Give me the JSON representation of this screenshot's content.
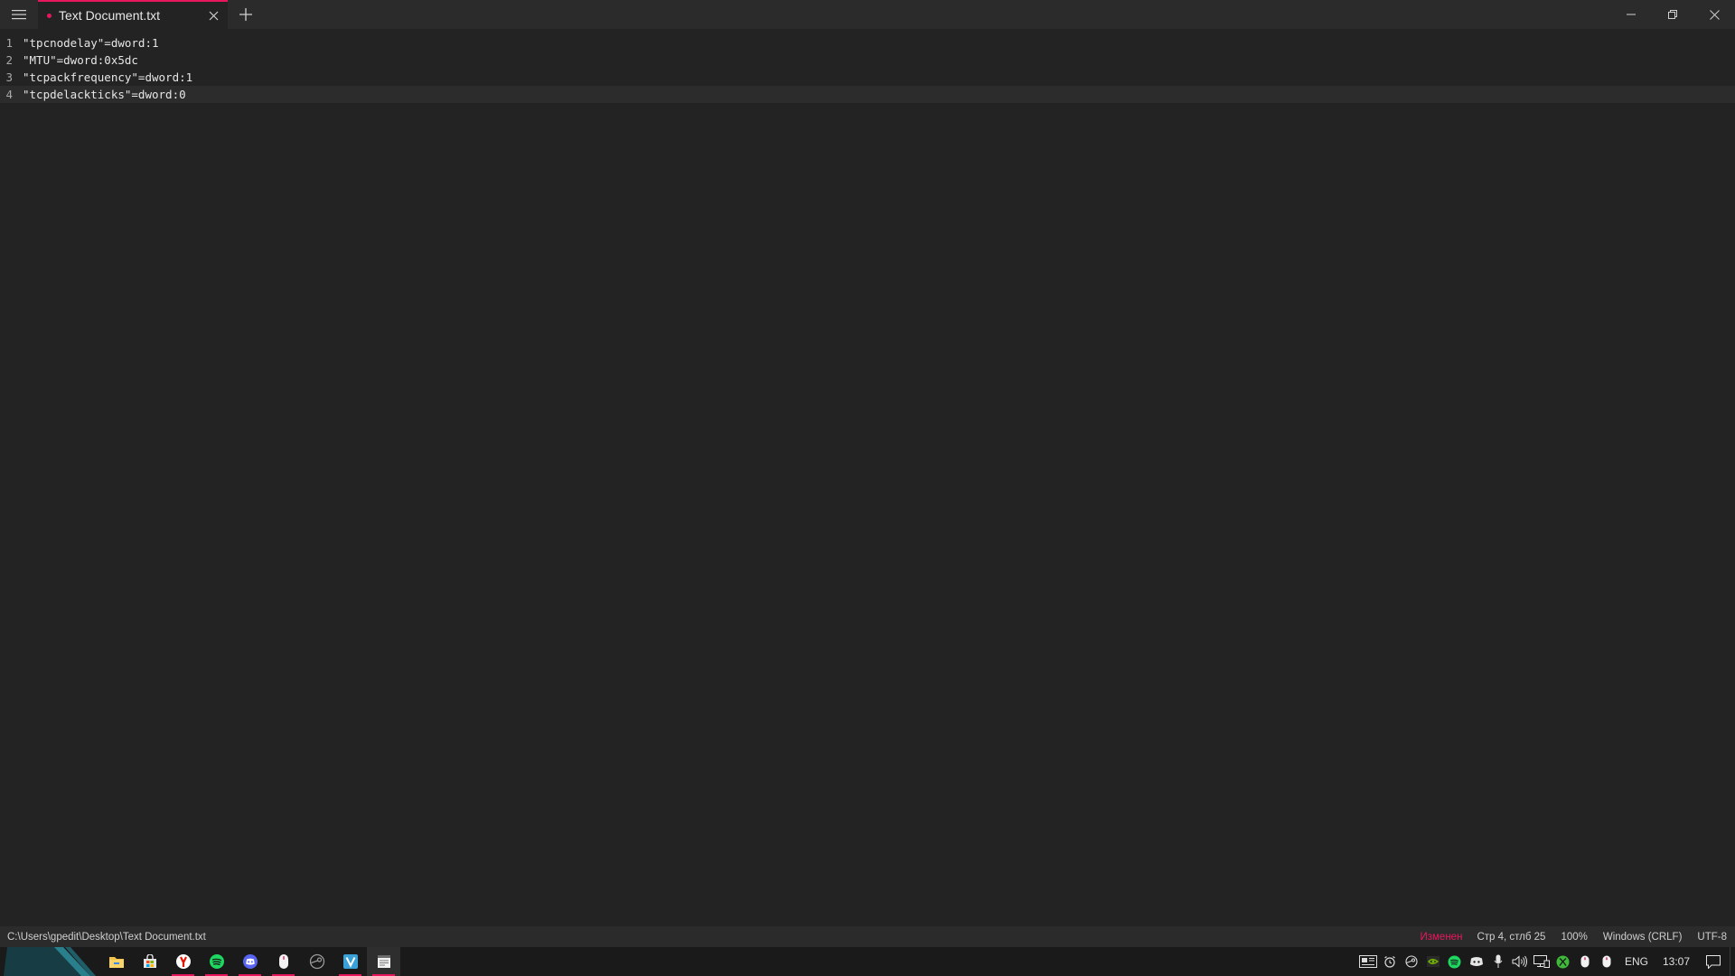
{
  "window": {
    "tab_title": "Text Document.txt",
    "accent": "#e8175d"
  },
  "editor": {
    "lines": [
      {
        "number": "1",
        "text": "\"tpcnodelay\"=dword:1"
      },
      {
        "number": "2",
        "text": "\"MTU\"=dword:0x5dc"
      },
      {
        "number": "3",
        "text": "\"tcpackfrequency\"=dword:1"
      },
      {
        "number": "4",
        "text": "\"tcpdelackticks\"=dword:0"
      }
    ],
    "current_line": 4
  },
  "statusbar": {
    "path": "C:\\Users\\gpedit\\Desktop\\Text Document.txt",
    "modified": "Изменен",
    "position": "Стр 4, стлб 25",
    "zoom": "100%",
    "line_ending": "Windows (CRLF)",
    "encoding": "UTF-8"
  },
  "taskbar": {
    "apps": [
      "file-explorer-icon",
      "store-icon",
      "yandex-browser-icon",
      "spotify-icon",
      "discord-icon",
      "mouse-app-icon",
      "steam-icon",
      "vpn-app-icon",
      "notepad-icon"
    ],
    "tray_icons": [
      "news-icon",
      "alarm-icon",
      "steam-tray-icon",
      "nvidia-icon",
      "spotify-tray-icon",
      "discord-tray-icon",
      "microphone-icon",
      "volume-icon",
      "network-icon",
      "xbox-icon",
      "mouse-tray-icon",
      "mouse-tray-icon-2"
    ],
    "language": "ENG",
    "time": "13:07"
  }
}
